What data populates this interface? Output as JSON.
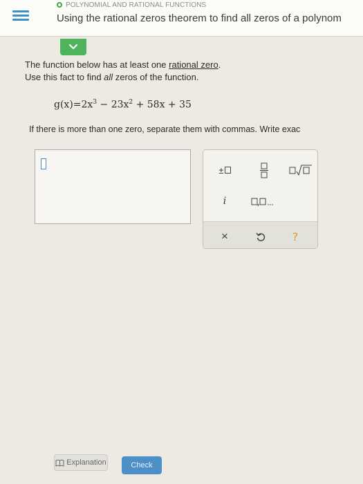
{
  "header": {
    "topic": "POLYNOMIAL AND RATIONAL FUNCTIONS",
    "title": "Using the rational zeros theorem to find all zeros of a polynom"
  },
  "problem": {
    "line1_pre": "The function below has at least one ",
    "line1_link": "rational zero",
    "line1_post": ".",
    "line2_pre": "Use this fact to find ",
    "line2_em": "all",
    "line2_post": " zeros of the function.",
    "formula": {
      "lhs": "g(x)=2x",
      "exp1": "3",
      "mid1": " − 23x",
      "exp2": "2",
      "rest": " + 58x + 35"
    },
    "instruction": "If there is more than one zero, separate them with commas. Write exac"
  },
  "keypad": {
    "plusminus": "±",
    "imag": "i",
    "clear": "×",
    "question": "?"
  },
  "buttons": {
    "explanation": "Explanation",
    "check": "Check"
  },
  "colors": {
    "accent_blue": "#4d8fc7",
    "accent_green": "#4fb35d"
  }
}
